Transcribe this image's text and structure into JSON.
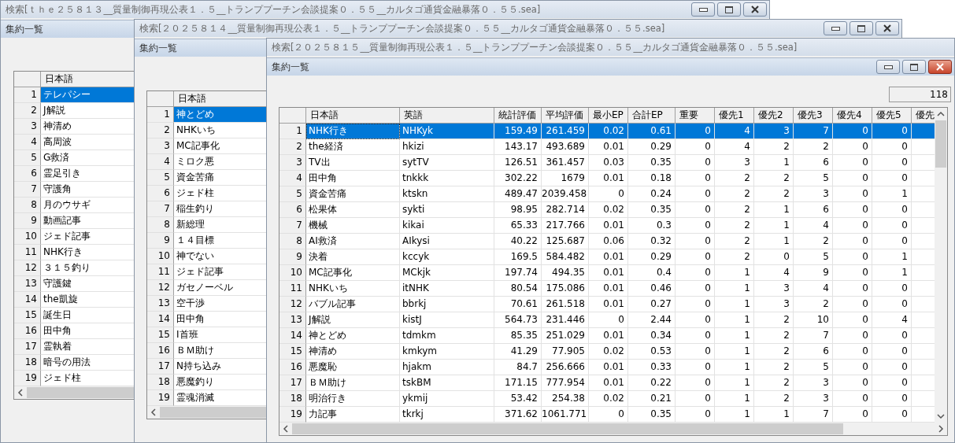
{
  "windows": [
    {
      "title": "検索[ｔｈｅ２５８１３__質量制御再現公表１．５__トランププーチン会談提案０．５５__カルタゴ通貨金融暴落０．５５.sea]",
      "controls": true,
      "child_title": "集約一覧",
      "child_controls": false,
      "grid": {
        "columns": [
          {
            "label": "日本語",
            "kind": "text"
          }
        ],
        "rows": [
          {
            "number": "1",
            "cells": [
              "テレパシー"
            ],
            "selected": true
          },
          {
            "number": "2",
            "cells": [
              "J解説"
            ],
            "selected": false
          },
          {
            "number": "3",
            "cells": [
              "神清め"
            ],
            "selected": false
          },
          {
            "number": "4",
            "cells": [
              "高周波"
            ],
            "selected": false
          },
          {
            "number": "5",
            "cells": [
              "G救済"
            ],
            "selected": false
          },
          {
            "number": "6",
            "cells": [
              "霊足引き"
            ],
            "selected": false
          },
          {
            "number": "7",
            "cells": [
              "守護角"
            ],
            "selected": false
          },
          {
            "number": "8",
            "cells": [
              "月のウサギ"
            ],
            "selected": false
          },
          {
            "number": "9",
            "cells": [
              "動画記事"
            ],
            "selected": false
          },
          {
            "number": "10",
            "cells": [
              "ジェド記事"
            ],
            "selected": false
          },
          {
            "number": "11",
            "cells": [
              "NHK行き"
            ],
            "selected": false
          },
          {
            "number": "12",
            "cells": [
              "３１５釣り"
            ],
            "selected": false
          },
          {
            "number": "13",
            "cells": [
              "守護鍵"
            ],
            "selected": false
          },
          {
            "number": "14",
            "cells": [
              "the凱旋"
            ],
            "selected": false
          },
          {
            "number": "15",
            "cells": [
              "誕生日"
            ],
            "selected": false
          },
          {
            "number": "16",
            "cells": [
              "田中角"
            ],
            "selected": false
          },
          {
            "number": "17",
            "cells": [
              "霊執着"
            ],
            "selected": false
          },
          {
            "number": "18",
            "cells": [
              "暗号の用法"
            ],
            "selected": false
          },
          {
            "number": "19",
            "cells": [
              "ジェド柱"
            ],
            "selected": false
          }
        ]
      }
    },
    {
      "title": "検索[２０２５８１４__質量制御再現公表１．５__トランププーチン会談提案０．５５__カルタゴ通貨金融暴落０．５５.sea]",
      "controls": true,
      "child_title": "集約一覧",
      "child_controls": false,
      "grid": {
        "columns": [
          {
            "label": "日本語",
            "kind": "text"
          }
        ],
        "rows": [
          {
            "number": "1",
            "cells": [
              "神とどめ"
            ],
            "selected": true
          },
          {
            "number": "2",
            "cells": [
              "NHKいち"
            ],
            "selected": false
          },
          {
            "number": "3",
            "cells": [
              "MC記事化"
            ],
            "selected": false
          },
          {
            "number": "4",
            "cells": [
              "ミロク悪"
            ],
            "selected": false
          },
          {
            "number": "5",
            "cells": [
              "資金苦痛"
            ],
            "selected": false
          },
          {
            "number": "6",
            "cells": [
              "ジェド柱"
            ],
            "selected": false
          },
          {
            "number": "7",
            "cells": [
              "稲生釣り"
            ],
            "selected": false
          },
          {
            "number": "8",
            "cells": [
              "新総理"
            ],
            "selected": false
          },
          {
            "number": "9",
            "cells": [
              "１４目標"
            ],
            "selected": false
          },
          {
            "number": "10",
            "cells": [
              "神でない"
            ],
            "selected": false
          },
          {
            "number": "11",
            "cells": [
              "ジェド記事"
            ],
            "selected": false
          },
          {
            "number": "12",
            "cells": [
              "ガセノーベル"
            ],
            "selected": false
          },
          {
            "number": "13",
            "cells": [
              "空干渉"
            ],
            "selected": false
          },
          {
            "number": "14",
            "cells": [
              "田中角"
            ],
            "selected": false
          },
          {
            "number": "15",
            "cells": [
              "I首班"
            ],
            "selected": false
          },
          {
            "number": "16",
            "cells": [
              "ＢＭ助け"
            ],
            "selected": false
          },
          {
            "number": "17",
            "cells": [
              "N持ち込み"
            ],
            "selected": false
          },
          {
            "number": "18",
            "cells": [
              "悪魔釣り"
            ],
            "selected": false
          },
          {
            "number": "19",
            "cells": [
              "霊魂消滅"
            ],
            "selected": false
          }
        ]
      }
    },
    {
      "title": "検索[２０２５８１５__質量制御再現公表１．５__トランププーチン会談提案０．５５__カルタゴ通貨金融暴落０．５５.sea]",
      "controls": false,
      "child_title": "集約一覧",
      "child_controls": true,
      "count": "118",
      "grid": {
        "columns": [
          {
            "label": "日本語",
            "kind": "text"
          },
          {
            "label": "英語",
            "kind": "text"
          },
          {
            "label": "統計評価",
            "kind": "number"
          },
          {
            "label": "平均評価",
            "kind": "number"
          },
          {
            "label": "最小EP",
            "kind": "number"
          },
          {
            "label": "合計EP",
            "kind": "number"
          },
          {
            "label": "重要",
            "kind": "number"
          },
          {
            "label": "優先1",
            "kind": "number"
          },
          {
            "label": "優先2",
            "kind": "number"
          },
          {
            "label": "優先3",
            "kind": "number"
          },
          {
            "label": "優先4",
            "kind": "number"
          },
          {
            "label": "優先5",
            "kind": "number"
          },
          {
            "label": "優先",
            "kind": "number"
          }
        ],
        "rows": [
          {
            "number": "1",
            "cells": [
              "NHK行き",
              "NHKyk",
              "159.49",
              "261.459",
              "0.02",
              "0.61",
              "0",
              "4",
              "3",
              "7",
              "0",
              "0"
            ],
            "selected": true
          },
          {
            "number": "2",
            "cells": [
              "the経済",
              "hkizi",
              "143.17",
              "493.689",
              "0.01",
              "0.29",
              "0",
              "4",
              "2",
              "2",
              "0",
              "0"
            ],
            "selected": false
          },
          {
            "number": "3",
            "cells": [
              "TV出",
              "sytTV",
              "126.51",
              "361.457",
              "0.03",
              "0.35",
              "0",
              "3",
              "1",
              "6",
              "0",
              "0"
            ],
            "selected": false
          },
          {
            "number": "4",
            "cells": [
              "田中角",
              "tnkkk",
              "302.22",
              "1679",
              "0.01",
              "0.18",
              "0",
              "2",
              "2",
              "5",
              "0",
              "0"
            ],
            "selected": false
          },
          {
            "number": "5",
            "cells": [
              "資金苦痛",
              "ktskn",
              "489.47",
              "2039.458",
              "0",
              "0.24",
              "0",
              "2",
              "2",
              "3",
              "0",
              "1"
            ],
            "selected": false
          },
          {
            "number": "6",
            "cells": [
              "松果体",
              "sykti",
              "98.95",
              "282.714",
              "0.02",
              "0.35",
              "0",
              "2",
              "1",
              "6",
              "0",
              "0"
            ],
            "selected": false
          },
          {
            "number": "7",
            "cells": [
              "機械",
              "kikai",
              "65.33",
              "217.766",
              "0.01",
              "0.3",
              "0",
              "2",
              "1",
              "4",
              "0",
              "0"
            ],
            "selected": false
          },
          {
            "number": "8",
            "cells": [
              "AI救済",
              "AIkysi",
              "40.22",
              "125.687",
              "0.06",
              "0.32",
              "0",
              "2",
              "1",
              "2",
              "0",
              "0"
            ],
            "selected": false
          },
          {
            "number": "9",
            "cells": [
              "決着",
              "kccyk",
              "169.5",
              "584.482",
              "0.01",
              "0.29",
              "0",
              "2",
              "0",
              "5",
              "0",
              "1"
            ],
            "selected": false
          },
          {
            "number": "10",
            "cells": [
              "MC記事化",
              "MCkjk",
              "197.74",
              "494.35",
              "0.01",
              "0.4",
              "0",
              "1",
              "4",
              "9",
              "0",
              "1"
            ],
            "selected": false
          },
          {
            "number": "11",
            "cells": [
              "NHKいち",
              "itNHK",
              "80.54",
              "175.086",
              "0.01",
              "0.46",
              "0",
              "1",
              "3",
              "4",
              "0",
              "0"
            ],
            "selected": false
          },
          {
            "number": "12",
            "cells": [
              "バブル記事",
              "bbrkj",
              "70.61",
              "261.518",
              "0.01",
              "0.27",
              "0",
              "1",
              "3",
              "2",
              "0",
              "0"
            ],
            "selected": false
          },
          {
            "number": "13",
            "cells": [
              "J解説",
              "kistJ",
              "564.73",
              "231.446",
              "0",
              "2.44",
              "0",
              "1",
              "2",
              "10",
              "0",
              "4"
            ],
            "selected": false
          },
          {
            "number": "14",
            "cells": [
              "神とどめ",
              "tdmkm",
              "85.35",
              "251.029",
              "0.01",
              "0.34",
              "0",
              "1",
              "2",
              "7",
              "0",
              "0"
            ],
            "selected": false
          },
          {
            "number": "15",
            "cells": [
              "神清め",
              "kmkym",
              "41.29",
              "77.905",
              "0.02",
              "0.53",
              "0",
              "1",
              "2",
              "6",
              "0",
              "0"
            ],
            "selected": false
          },
          {
            "number": "16",
            "cells": [
              "悪魔恥",
              "hjakm",
              "84.7",
              "256.666",
              "0.01",
              "0.33",
              "0",
              "1",
              "2",
              "5",
              "0",
              "0"
            ],
            "selected": false
          },
          {
            "number": "17",
            "cells": [
              "ＢＭ助け",
              "tskBM",
              "171.15",
              "777.954",
              "0.01",
              "0.22",
              "0",
              "1",
              "2",
              "3",
              "0",
              "0"
            ],
            "selected": false
          },
          {
            "number": "18",
            "cells": [
              "明治行き",
              "ykmij",
              "53.42",
              "254.38",
              "0.02",
              "0.21",
              "0",
              "1",
              "2",
              "3",
              "0",
              "0"
            ],
            "selected": false
          },
          {
            "number": "19",
            "cells": [
              "力記事",
              "tkrkj",
              "371.62",
              "1061.771",
              "0",
              "0.35",
              "0",
              "1",
              "1",
              "7",
              "0",
              "0"
            ],
            "selected": false
          }
        ]
      }
    }
  ]
}
